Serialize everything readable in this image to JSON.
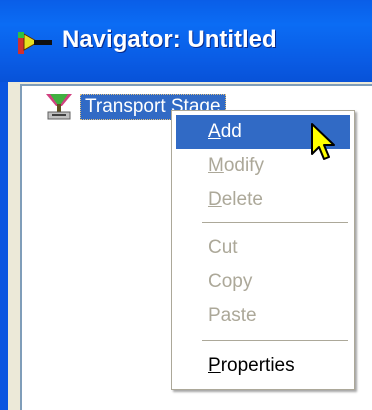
{
  "window": {
    "title": "Navigator: Untitled"
  },
  "tree": {
    "node_label": "Transport Stage"
  },
  "context_menu": {
    "items": [
      {
        "label": "Add",
        "accel": "A",
        "rest": "dd",
        "enabled": true,
        "highlighted": true
      },
      {
        "label": "Modify",
        "accel": "M",
        "rest": "odify",
        "enabled": false
      },
      {
        "label": "Delete",
        "accel": "D",
        "rest": "elete",
        "enabled": false
      },
      {
        "label": "Cut",
        "accel": "",
        "rest": "Cut",
        "enabled": false
      },
      {
        "label": "Copy",
        "accel": "",
        "rest": "Copy",
        "enabled": false
      },
      {
        "label": "Paste",
        "accel": "",
        "rest": "Paste",
        "enabled": false
      },
      {
        "label": "Properties",
        "accel": "P",
        "rest": "roperties",
        "enabled": true
      }
    ]
  },
  "colors": {
    "titlebar": "#0a5ee8",
    "selection": "#316ac5",
    "disabled_text": "#aca899",
    "cursor": "#ffff00"
  },
  "icons": {
    "app": "navigator-app-icon",
    "node": "transport-stage-icon",
    "pointer": "mouse-pointer-icon"
  }
}
